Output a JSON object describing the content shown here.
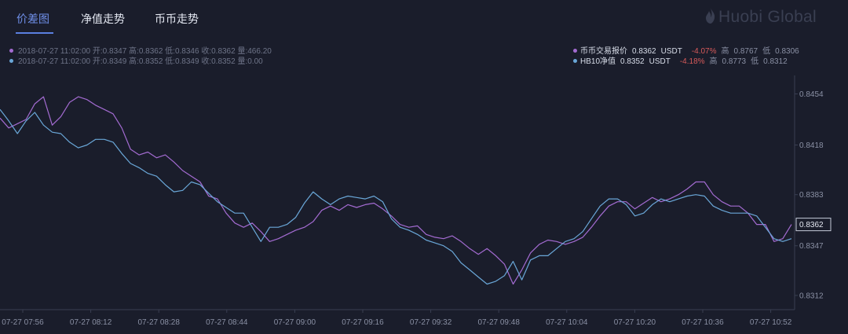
{
  "tabs": [
    {
      "label": "价差图",
      "active": true
    },
    {
      "label": "净值走势",
      "active": false
    },
    {
      "label": "币币走势",
      "active": false
    }
  ],
  "logo": {
    "text": "Huobi Global"
  },
  "info_rows": [
    {
      "text": "2018-07-27 11:02:00  开:0.8347  高:0.8362  低:0.8346  收:0.8362  量:466.20",
      "color": "#a36bd1"
    },
    {
      "text": "2018-07-27 11:02:00  开:0.8349  高:0.8352  低:0.8349  收:0.8352  量:0.00",
      "color": "#6aa7d8"
    }
  ],
  "legend": [
    {
      "name": "币币交易报价",
      "value": "0.8362",
      "unit": "USDT",
      "change": "-4.07%",
      "high_label": "高",
      "high": "0.8767",
      "low_label": "低",
      "low": "0.8306",
      "color": "#a36bd1"
    },
    {
      "name": "HB10净值",
      "value": "0.8352",
      "unit": "USDT",
      "change": "-4.18%",
      "high_label": "高",
      "high": "0.8773",
      "low_label": "低",
      "low": "0.8312",
      "color": "#6aa7d8"
    }
  ],
  "chart_data": {
    "type": "line",
    "x_ticks": [
      "07-27 07:56",
      "07-27 08:12",
      "07-27 08:28",
      "07-27 08:44",
      "07-27 09:00",
      "07-27 09:16",
      "07-27 09:32",
      "07-27 09:48",
      "07-27 10:04",
      "07-27 10:20",
      "07-27 10:36",
      "07-27 10:52"
    ],
    "y_ticks": [
      0.8454,
      0.8418,
      0.8383,
      0.8347,
      0.8312
    ],
    "ylim": [
      0.8302,
      0.8467
    ],
    "current_value_label": "0.8362",
    "grid": false,
    "series": [
      {
        "name": "币币交易报价",
        "color": "#a36bd1",
        "values": [
          0.8437,
          0.843,
          0.8433,
          0.8436,
          0.8447,
          0.8452,
          0.8432,
          0.8438,
          0.8448,
          0.8452,
          0.845,
          0.8446,
          0.8443,
          0.844,
          0.843,
          0.8415,
          0.8411,
          0.8413,
          0.8409,
          0.8411,
          0.8406,
          0.84,
          0.8396,
          0.8392,
          0.8382,
          0.838,
          0.837,
          0.8363,
          0.836,
          0.8363,
          0.8357,
          0.835,
          0.8352,
          0.8355,
          0.8358,
          0.836,
          0.8364,
          0.8372,
          0.8375,
          0.8372,
          0.8376,
          0.8374,
          0.8376,
          0.8377,
          0.8373,
          0.8368,
          0.8362,
          0.836,
          0.8361,
          0.8355,
          0.8353,
          0.8352,
          0.8354,
          0.835,
          0.8345,
          0.8341,
          0.8345,
          0.834,
          0.8334,
          0.832,
          0.833,
          0.8342,
          0.8348,
          0.8351,
          0.835,
          0.8348,
          0.835,
          0.8353,
          0.836,
          0.8368,
          0.8375,
          0.8378,
          0.8378,
          0.8373,
          0.8377,
          0.8381,
          0.8378,
          0.838,
          0.8383,
          0.8387,
          0.8392,
          0.8392,
          0.8383,
          0.8378,
          0.8375,
          0.8375,
          0.837,
          0.8362,
          0.8362,
          0.835,
          0.8352,
          0.8362
        ]
      },
      {
        "name": "HB10净值",
        "color": "#6aa7d8",
        "values": [
          0.8443,
          0.8435,
          0.8426,
          0.8435,
          0.8441,
          0.8432,
          0.8427,
          0.8426,
          0.842,
          0.8416,
          0.8418,
          0.8422,
          0.8422,
          0.842,
          0.8412,
          0.8405,
          0.8402,
          0.8398,
          0.8396,
          0.839,
          0.8385,
          0.8386,
          0.8392,
          0.839,
          0.8384,
          0.8378,
          0.8374,
          0.837,
          0.837,
          0.836,
          0.835,
          0.836,
          0.836,
          0.8362,
          0.8367,
          0.8377,
          0.8385,
          0.838,
          0.8376,
          0.838,
          0.8382,
          0.8381,
          0.838,
          0.8382,
          0.8378,
          0.8366,
          0.836,
          0.8358,
          0.8355,
          0.8351,
          0.8349,
          0.8347,
          0.8343,
          0.8335,
          0.833,
          0.8325,
          0.832,
          0.8322,
          0.8326,
          0.8336,
          0.8323,
          0.8337,
          0.834,
          0.834,
          0.8345,
          0.835,
          0.8352,
          0.8357,
          0.8366,
          0.8375,
          0.838,
          0.838,
          0.8376,
          0.8368,
          0.837,
          0.8376,
          0.838,
          0.8378,
          0.838,
          0.8382,
          0.8383,
          0.8382,
          0.8375,
          0.8372,
          0.837,
          0.837,
          0.837,
          0.8368,
          0.836,
          0.8352,
          0.835,
          0.8352
        ]
      }
    ]
  }
}
